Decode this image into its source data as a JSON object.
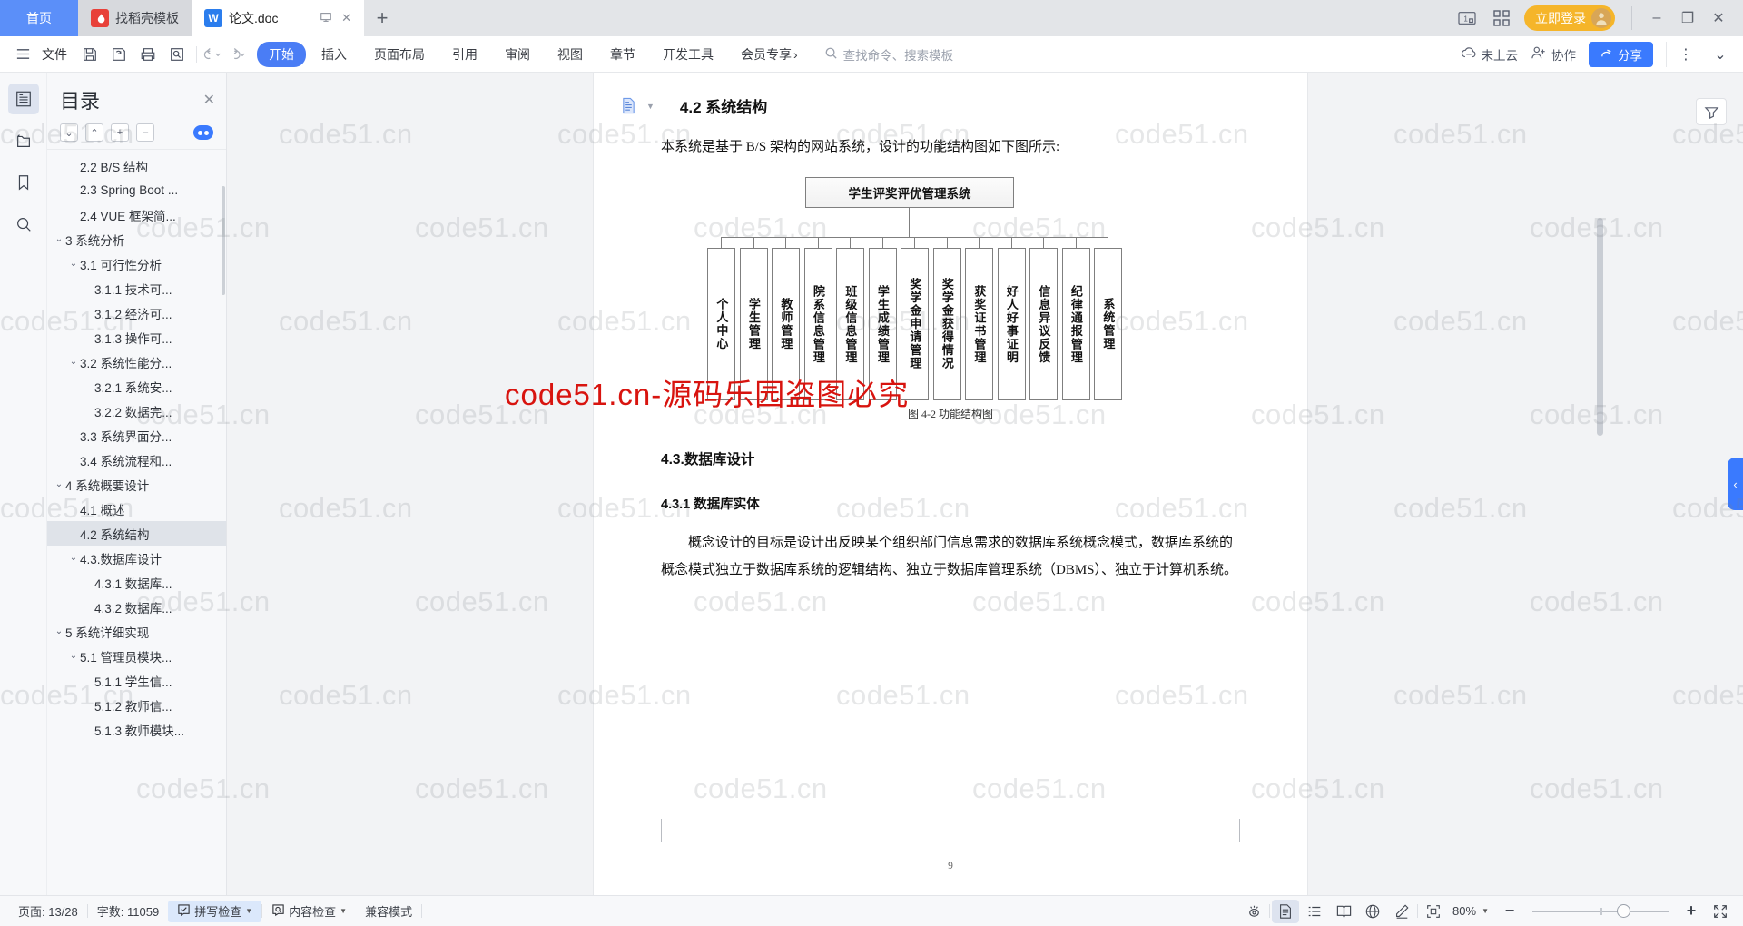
{
  "tabbar": {
    "home_label": "首页",
    "template_tab": {
      "label": "找稻壳模板",
      "icon": "dao-ke-icon"
    },
    "doc_tab": {
      "label": "论文.doc",
      "icon": "wps-writer-icon"
    },
    "new_tab_label": "+",
    "restore_icon": "restore-down-icon",
    "close_icon": "close-icon",
    "count_icon": "tab-count-icon",
    "grid_icon": "apps-grid-icon",
    "login_label": "立即登录",
    "minimize": "–",
    "maximize": "❐",
    "close": "✕"
  },
  "ribbon": {
    "file_label": "文件",
    "menu_icon": "hamburger-menu-icon",
    "quick_icons": [
      "save-icon",
      "save-as-cloud-icon",
      "print-icon",
      "print-preview-icon"
    ],
    "undo_icon": "undo-icon",
    "redo_icon": "redo-icon",
    "tabs": [
      {
        "label": "开始",
        "selected": true
      },
      {
        "label": "插入",
        "selected": false
      },
      {
        "label": "页面布局",
        "selected": false
      },
      {
        "label": "引用",
        "selected": false
      },
      {
        "label": "审阅",
        "selected": false
      },
      {
        "label": "视图",
        "selected": false
      },
      {
        "label": "章节",
        "selected": false
      },
      {
        "label": "开发工具",
        "selected": false
      },
      {
        "label": "会员专享",
        "selected": false
      }
    ],
    "search_placeholder": "查找命令、搜索模板",
    "cloud_label": "未上云",
    "collab_label": "协作",
    "share_label": "分享",
    "more_icon": "more-vertical-icon",
    "collapse_icon": "chevron-down-icon"
  },
  "rail": {
    "items": [
      {
        "name": "outline-icon",
        "active": true
      },
      {
        "name": "thumbnail-icon",
        "active": false
      },
      {
        "name": "bookmark-icon",
        "active": false
      },
      {
        "name": "search-icon",
        "active": false
      }
    ]
  },
  "toc": {
    "title": "目录",
    "close_icon": "close-icon",
    "tools": [
      {
        "name": "expand-down-button",
        "glyph": "⌄"
      },
      {
        "name": "collapse-up-button",
        "glyph": "⌃"
      },
      {
        "name": "expand-all-button",
        "glyph": "+"
      },
      {
        "name": "collapse-all-button",
        "glyph": "–"
      }
    ],
    "items": [
      {
        "label": "2.2 B/S 结构",
        "indent": 2,
        "caret": "",
        "selected": false
      },
      {
        "label": "2.3 Spring Boot ...",
        "indent": 2,
        "caret": "",
        "selected": false
      },
      {
        "label": "2.4 VUE 框架简...",
        "indent": 2,
        "caret": "",
        "selected": false
      },
      {
        "label": "3 系统分析",
        "indent": 1,
        "caret": "⌄",
        "selected": false
      },
      {
        "label": "3.1 可行性分析",
        "indent": 2,
        "caret": "⌄",
        "selected": false
      },
      {
        "label": "3.1.1 技术可...",
        "indent": 3,
        "caret": "",
        "selected": false
      },
      {
        "label": "3.1.2 经济可...",
        "indent": 3,
        "caret": "",
        "selected": false
      },
      {
        "label": "3.1.3 操作可...",
        "indent": 3,
        "caret": "",
        "selected": false
      },
      {
        "label": "3.2 系统性能分...",
        "indent": 2,
        "caret": "⌄",
        "selected": false
      },
      {
        "label": "3.2.1 系统安...",
        "indent": 3,
        "caret": "",
        "selected": false
      },
      {
        "label": "3.2.2 数据完...",
        "indent": 3,
        "caret": "",
        "selected": false
      },
      {
        "label": "3.3 系统界面分...",
        "indent": 2,
        "caret": "",
        "selected": false
      },
      {
        "label": "3.4 系统流程和...",
        "indent": 2,
        "caret": "",
        "selected": false
      },
      {
        "label": "4 系统概要设计",
        "indent": 1,
        "caret": "⌄",
        "selected": false
      },
      {
        "label": "4.1 概述",
        "indent": 2,
        "caret": "",
        "selected": false
      },
      {
        "label": "4.2 系统结构",
        "indent": 2,
        "caret": "",
        "selected": true
      },
      {
        "label": "4.3.数据库设计",
        "indent": 2,
        "caret": "⌄",
        "selected": false
      },
      {
        "label": "4.3.1 数据库...",
        "indent": 3,
        "caret": "",
        "selected": false
      },
      {
        "label": "4.3.2 数据库...",
        "indent": 3,
        "caret": "",
        "selected": false
      },
      {
        "label": "5 系统详细实现",
        "indent": 1,
        "caret": "⌄",
        "selected": false
      },
      {
        "label": "5.1 管理员模块...",
        "indent": 2,
        "caret": "⌄",
        "selected": false
      },
      {
        "label": "5.1.1 学生信...",
        "indent": 3,
        "caret": "",
        "selected": false
      },
      {
        "label": "5.1.2 教师信...",
        "indent": 3,
        "caret": "",
        "selected": false
      },
      {
        "label": "5.1.3 教师模块...",
        "indent": 3,
        "caret": "",
        "selected": false
      }
    ]
  },
  "document": {
    "heading_icon": "paragraph-style-icon",
    "heading": "4.2 系统结构",
    "intro_paragraph": "本系统是基于 B/S 架构的网站系统，设计的功能结构图如下图所示:",
    "figure_caption": "图 4-2 功能结构图",
    "section_43": "4.3.数据库设计",
    "section_431": "4.3.1 数据库实体",
    "body_paragraph": "概念设计的目标是设计出反映某个组织部门信息需求的数据库系统概念模式，数据库系统的概念模式独立于数据库系统的逻辑结构、独立于数据库管理系统（DBMS）、独立于计算机系统。",
    "page_number": "9",
    "watermark_red": "code51.cn-源码乐园盗图必究",
    "watermark_text": "code51.cn"
  },
  "chart_data": {
    "type": "diagram",
    "title": "图 4-2 功能结构图",
    "root": "学生评奖评优管理系统",
    "leaves": [
      "个人中心",
      "学生管理",
      "教师管理",
      "院系信息管理",
      "班级信息管理",
      "学生成绩管理",
      "奖学金申请管理",
      "奖学金获得情况",
      "获奖证书管理",
      "好人好事证明",
      "信息异议反馈",
      "纪律通报管理",
      "系统管理"
    ]
  },
  "right_panel": {
    "filter_icon": "filter-icon",
    "handle_icon": "chevron-left-icon"
  },
  "status": {
    "page_label": "页面: 13/28",
    "word_count_label": "字数: 11059",
    "spellcheck_label": "拼写检查",
    "content_check_label": "内容检查",
    "compat_label": "兼容模式",
    "view_icons": [
      {
        "name": "focus-eye-icon",
        "active": false
      },
      {
        "name": "page-view-icon",
        "active": true
      },
      {
        "name": "outline-view-icon",
        "active": false
      },
      {
        "name": "reading-view-icon",
        "active": false
      },
      {
        "name": "web-view-icon",
        "active": false
      },
      {
        "name": "highlight-pen-icon",
        "active": false
      }
    ],
    "fit_icon": "fit-page-icon",
    "zoom_value": "80%",
    "zoom_out": "−",
    "zoom_in": "+",
    "fullscreen_icon": "fullscreen-icon"
  },
  "colors": {
    "accent_blue": "#3a7afe",
    "tab_active_blue": "#4a7df5",
    "login_yellow": "#f5b52a",
    "home_blue": "#5b8ff9",
    "watermark_red": "#d8140f"
  }
}
